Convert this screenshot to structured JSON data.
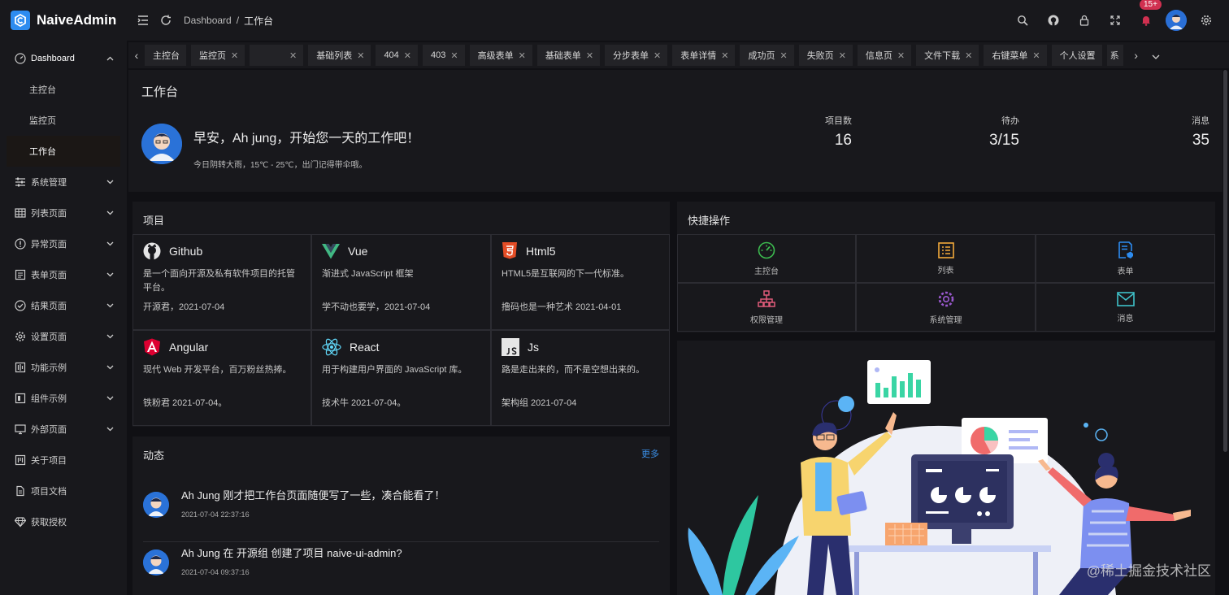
{
  "app": {
    "title": "NaiveAdmin"
  },
  "breadcrumb": {
    "root": "Dashboard",
    "sep": "/",
    "current": "工作台"
  },
  "header": {
    "badge": "15+"
  },
  "sidebar": {
    "dashboard": "Dashboard",
    "sub": [
      "主控台",
      "监控页",
      "工作台"
    ],
    "items": [
      "系统管理",
      "列表页面",
      "异常页面",
      "表单页面",
      "结果页面",
      "设置页面",
      "功能示例",
      "组件示例",
      "外部页面",
      "关于项目",
      "项目文档",
      "获取授权"
    ]
  },
  "tabs": [
    "主控台",
    "监控页",
    "",
    "基础列表",
    "404",
    "403",
    "高级表单",
    "基础表单",
    "分步表单",
    "表单详情",
    "成功页",
    "失败页",
    "信息页",
    "文件下载",
    "右键菜单",
    "个人设置",
    "系"
  ],
  "workbench": {
    "title": "工作台",
    "greeting": "早安，Ah jung，开始您一天的工作吧！",
    "weather": "今日阴转大雨，15℃ - 25℃，出门记得带伞哦。",
    "stats": [
      {
        "label": "项目数",
        "value": "16"
      },
      {
        "label": "待办",
        "value": "3/15"
      },
      {
        "label": "消息",
        "value": "35"
      }
    ]
  },
  "projects": {
    "title": "项目",
    "items": [
      {
        "name": "Github",
        "desc": "是一个面向开源及私有软件项目的托管平台。",
        "foot": "开源君，2021-07-04"
      },
      {
        "name": "Vue",
        "desc": "渐进式 JavaScript 框架",
        "foot": "学不动也要学，2021-07-04"
      },
      {
        "name": "Html5",
        "desc": "HTML5是互联网的下一代标准。",
        "foot": "撸码也是一种艺术 2021-04-01"
      },
      {
        "name": "Angular",
        "desc": "现代 Web 开发平台，百万粉丝热捧。",
        "foot": "铁粉君 2021-07-04。"
      },
      {
        "name": "React",
        "desc": "用于构建用户界面的 JavaScript 库。",
        "foot": "技术牛 2021-07-04。"
      },
      {
        "name": "Js",
        "desc": "路是走出来的，而不是空想出来的。",
        "foot": "架构组 2021-07-04"
      }
    ]
  },
  "quick": {
    "title": "快捷操作",
    "items": [
      "主控台",
      "列表",
      "表单",
      "权限管理",
      "系统管理",
      "消息"
    ]
  },
  "dynamics": {
    "title": "动态",
    "more": "更多",
    "items": [
      {
        "text": "Ah Jung 刚才把工作台页面随便写了一些，凑合能看了！",
        "time": "2021-07-04 22:37:16"
      },
      {
        "text": "Ah Jung 在 开源组 创建了项目 naive-ui-admin?",
        "time": "2021-07-04 09:37:16"
      }
    ]
  },
  "watermark": "@稀土掘金技术社区",
  "colors": {
    "accent": "#2d8cf0",
    "badge": "#d03050",
    "link": "#3a8ee6"
  }
}
